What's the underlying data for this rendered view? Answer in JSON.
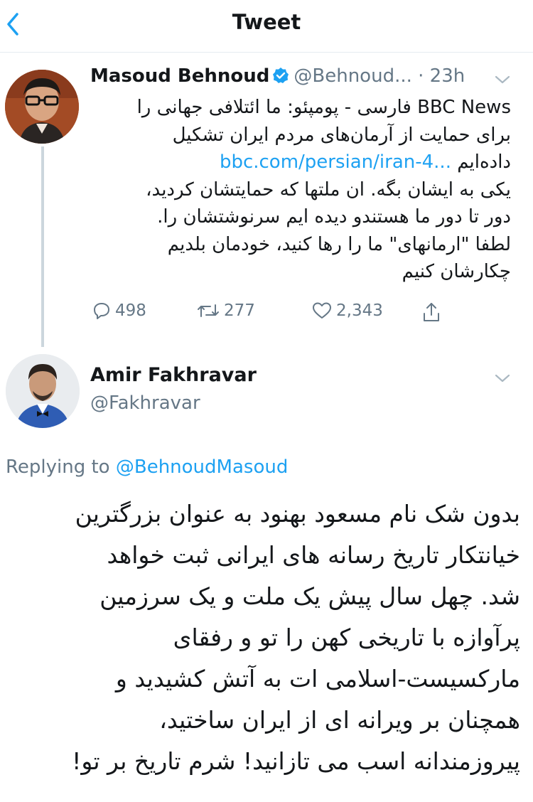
{
  "header": {
    "title": "Tweet",
    "back_icon": "chevron-left-icon"
  },
  "tweet": {
    "author_name": "Masoud Behnoud",
    "verified": true,
    "author_handle": "@Behnoud...",
    "time": "· 23h",
    "body_lines": [
      "BBC News فارسی - پومپئو: ما ائتلافی جهانی را",
      "برای حمایت از آرمان‌های مردم ایران تشکیل",
      "داده‌ایم",
      "یکی به ایشان بگه. ان ملتها که حمایتشان کردید،",
      "دور تا دور ما هستندو دیده ایم سرنوشتشان را.",
      "لطفا \"ارمانهای\" ما را رها کنید، خودمان بلدیم",
      "چکارشان کنیم"
    ],
    "link": "bbc.com/persian/iran-4...",
    "stats": {
      "replies": "498",
      "retweets": "277",
      "likes": "2,343"
    },
    "accent_color": "#1da1f2"
  },
  "reply": {
    "author_name": "Amir Fakhravar",
    "author_handle": "@Fakhravar",
    "replying_prefix": "Replying to",
    "replying_to": "@BehnoudMasoud",
    "body_lines": [
      "بدون شک نام مسعود بهنود به عنوان بزرگترین",
      "خیانتکار تاریخ رسانه های ایرانی ثبت خواهد",
      "شد. چهل سال پیش یک ملت و یک سرزمین",
      "پرآوازه با تاریخی کهن را تو و رفقای",
      "مارکسیست-اسلامی ات به آتش کشیدید و",
      "همچنان بر ویرانه ای از ایران ساختید،",
      "پیروزمندانه اسب می تازانید! شرم تاریخ بر تو!"
    ]
  }
}
